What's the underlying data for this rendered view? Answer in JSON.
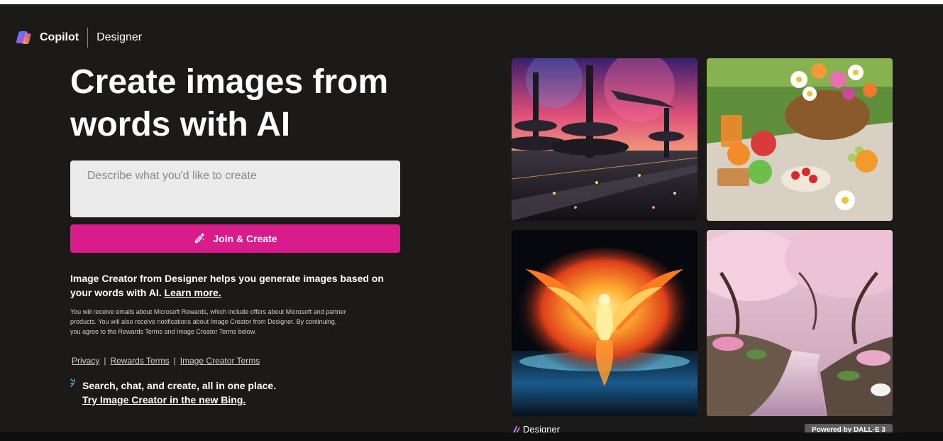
{
  "header": {
    "brand": "Copilot",
    "product": "Designer"
  },
  "hero": {
    "title_line1": "Create images from",
    "title_line2": "words with AI"
  },
  "prompt": {
    "placeholder": "Describe what you'd like to create",
    "value": ""
  },
  "cta": {
    "label": "Join & Create",
    "color": "#d91b8c"
  },
  "description": {
    "text": "Image Creator from Designer helps you generate images based on your words with AI.",
    "link": "Learn more."
  },
  "fineprint": "You will receive emails about Microsoft Rewards, which include offers about Microsoft and partner products. You will also receive notifications about Image Creator from Designer. By continuing, you agree to the Rewards Terms and Image Creator Terms below.",
  "legal": {
    "privacy": "Privacy",
    "separator": "|",
    "rewards_terms": "Rewards Terms",
    "image_creator_terms": "Image Creator Terms"
  },
  "promo": {
    "text": "Search, chat, and create, all in one place.",
    "link": "Try Image Creator in the new Bing."
  },
  "gallery": {
    "images": [
      {
        "subject": "futuristic-spaceport"
      },
      {
        "subject": "picnic-flowers-fruit"
      },
      {
        "subject": "fire-phoenix"
      },
      {
        "subject": "cherry-blossom-river"
      }
    ]
  },
  "footer": {
    "designer": "Designer",
    "badge": "Powered by DALL·E 3"
  },
  "colors": {
    "background": "#1b1a19",
    "accent": "#d91b8c"
  }
}
